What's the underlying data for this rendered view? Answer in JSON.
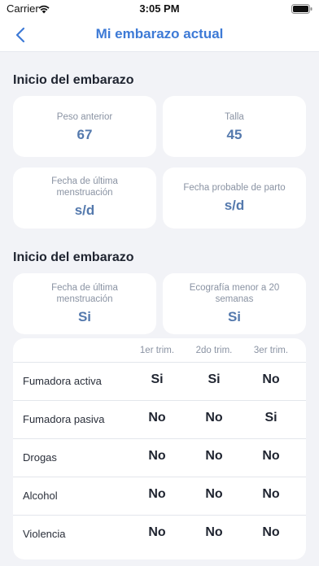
{
  "status_bar": {
    "carrier": "Carrier",
    "time": "3:05 PM"
  },
  "nav": {
    "title": "Mi embarazo actual"
  },
  "section1": {
    "title": "Inicio del embarazo",
    "cards": [
      {
        "label": "Peso anterior",
        "value": "67"
      },
      {
        "label": "Talla",
        "value": "45"
      },
      {
        "label": "Fecha de última menstruación",
        "value": "s/d"
      },
      {
        "label": "Fecha probable de parto",
        "value": "s/d"
      }
    ]
  },
  "section2": {
    "title": "Inicio del embarazo",
    "cards": [
      {
        "label": "Fecha de última menstruación",
        "value": "Si"
      },
      {
        "label": "Ecografía menor a 20 semanas",
        "value": "Si"
      }
    ]
  },
  "table": {
    "columns": [
      "1er trim.",
      "2do trim.",
      "3er trim."
    ],
    "rows": [
      {
        "label": "Fumadora activa",
        "values": [
          "Si",
          "Si",
          "No"
        ]
      },
      {
        "label": "Fumadora pasiva",
        "values": [
          "No",
          "No",
          "Si"
        ]
      },
      {
        "label": "Drogas",
        "values": [
          "No",
          "No",
          "No"
        ]
      },
      {
        "label": "Alcohol",
        "values": [
          "No",
          "No",
          "No"
        ]
      },
      {
        "label": "Violencia",
        "values": [
          "No",
          "No",
          "No"
        ]
      }
    ]
  }
}
